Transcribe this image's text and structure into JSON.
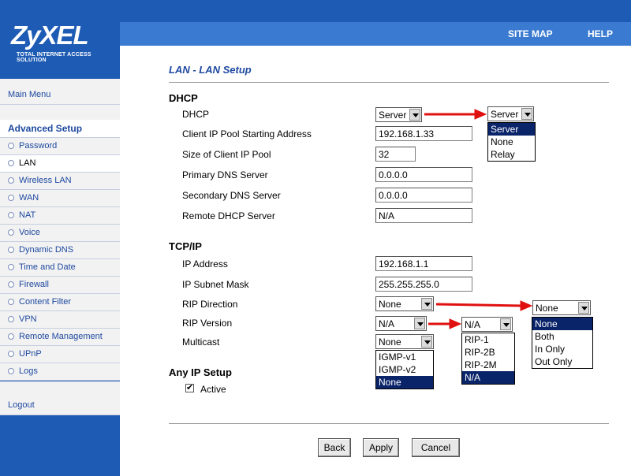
{
  "brand": {
    "logo": "ZyXEL",
    "tagline": "TOTAL INTERNET ACCESS SOLUTION"
  },
  "top_links": {
    "site_map": "SITE MAP",
    "help": "HELP"
  },
  "sidebar": {
    "main_menu": "Main Menu",
    "advanced_setup": "Advanced Setup",
    "items": [
      "Password",
      "LAN",
      "Wireless LAN",
      "WAN",
      "NAT",
      "Voice",
      "Dynamic DNS",
      "Time and Date",
      "Firewall",
      "Content Filter",
      "VPN",
      "Remote Management",
      "UPnP",
      "Logs"
    ],
    "active_item": "LAN",
    "logout": "Logout"
  },
  "page_title": "LAN - LAN Setup",
  "dhcp": {
    "heading": "DHCP",
    "labels": {
      "dhcp": "DHCP",
      "pool_start": "Client IP Pool Starting Address",
      "pool_size": "Size of Client IP Pool",
      "primary_dns": "Primary DNS Server",
      "secondary_dns": "Secondary DNS Server",
      "remote_dhcp": "Remote DHCP Server"
    },
    "values": {
      "dhcp": "Server",
      "pool_start": "192.168.1.33",
      "pool_size": "32",
      "primary_dns": "0.0.0.0",
      "secondary_dns": "0.0.0.0",
      "remote_dhcp": "N/A"
    },
    "dhcp_options": [
      "Server",
      "None",
      "Relay"
    ]
  },
  "tcpip": {
    "heading": "TCP/IP",
    "labels": {
      "ip": "IP Address",
      "mask": "IP Subnet Mask",
      "rip_direction": "RIP Direction",
      "rip_version": "RIP Version",
      "multicast": "Multicast"
    },
    "values": {
      "ip": "192.168.1.1",
      "mask": "255.255.255.0",
      "rip_direction": "None",
      "rip_version": "N/A",
      "multicast": "None"
    },
    "rip_direction_options": [
      "None",
      "Both",
      "In Only",
      "Out Only"
    ],
    "rip_version_options": [
      "RIP-1",
      "RIP-2B",
      "RIP-2M",
      "N/A"
    ],
    "multicast_options": [
      "IGMP-v1",
      "IGMP-v2",
      "None"
    ]
  },
  "any_ip": {
    "heading": "Any IP Setup",
    "active_label": "Active",
    "active_checked": true
  },
  "buttons": {
    "back": "Back",
    "apply": "Apply",
    "cancel": "Cancel"
  },
  "colors": {
    "brand_blue": "#1e5bb5",
    "title_blue": "#1e49a0",
    "arrow_red": "#e01010",
    "highlight": "#0a246a"
  }
}
